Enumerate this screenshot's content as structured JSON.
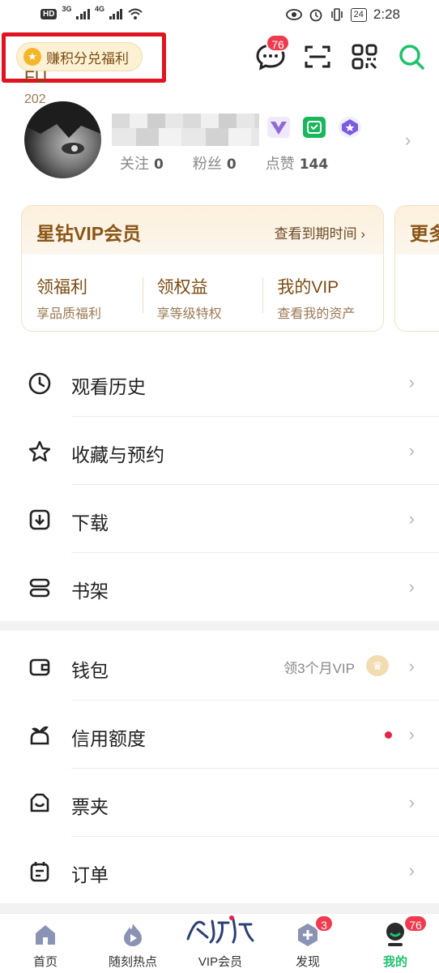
{
  "status_bar": {
    "network_badge": "HD",
    "sim_1": "3G",
    "sim_2": "4G",
    "battery": "24",
    "time": "2:28"
  },
  "header": {
    "earn_label": "赚积分兑福利",
    "messages_badge": "76",
    "icons": [
      "chat-icon",
      "scan-icon",
      "qrcode-icon",
      "search-icon"
    ]
  },
  "profile": {
    "stats": [
      {
        "label": "关注",
        "value": "0"
      },
      {
        "label": "粉丝",
        "value": "0"
      },
      {
        "label": "点赞",
        "value": "144"
      }
    ]
  },
  "vip_card": {
    "title": "星钻VIP会员",
    "expire_link": "查看到期时间",
    "items": [
      {
        "title": "领福利",
        "subtitle": "享品质福利"
      },
      {
        "title": "领权益",
        "subtitle": "享等级特权"
      },
      {
        "title": "我的VIP",
        "subtitle": "查看我的资产"
      }
    ],
    "next_card_title": "更多",
    "next_card_line1": "FU",
    "next_card_line2": "202"
  },
  "menu_group_1": [
    {
      "label": "观看历史",
      "icon": "clock-icon"
    },
    {
      "label": "收藏与预约",
      "icon": "star-icon"
    },
    {
      "label": "下载",
      "icon": "download-icon"
    },
    {
      "label": "书架",
      "icon": "bookshelf-icon"
    }
  ],
  "menu_group_2": [
    {
      "label": "钱包",
      "icon": "wallet-icon",
      "tip": "领3个月VIP"
    },
    {
      "label": "信用额度",
      "icon": "credit-icon"
    },
    {
      "label": "票夹",
      "icon": "ticket-icon"
    },
    {
      "label": "订单",
      "icon": "order-icon"
    }
  ],
  "tab_bar": [
    {
      "label": "首页",
      "icon": "home-icon"
    },
    {
      "label": "随刻热点",
      "icon": "flame-icon"
    },
    {
      "label": "VIP会员",
      "icon": "vip-icon"
    },
    {
      "label": "发现",
      "icon": "discover-icon",
      "badge": "3"
    },
    {
      "label": "我的",
      "icon": "profile-icon",
      "badge": "76",
      "active": true
    }
  ],
  "colors": {
    "accent_green": "#1dc36b",
    "badge_red": "#f03a4e",
    "vip_gold": "#8a5414",
    "highlight_red": "#e0141e"
  }
}
